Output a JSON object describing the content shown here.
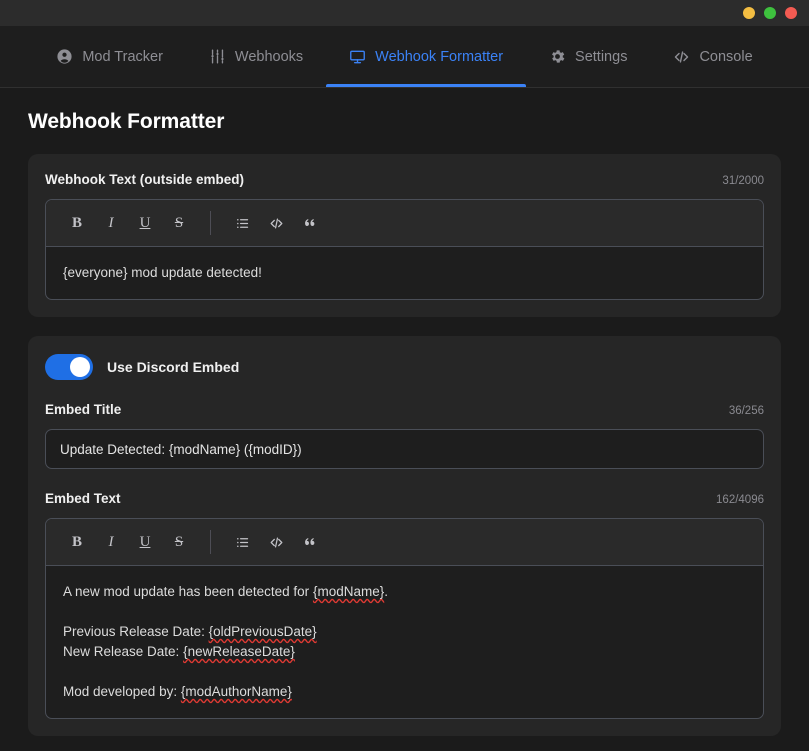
{
  "window": {
    "controls": [
      {
        "name": "minimize",
        "color": "#f3bd42"
      },
      {
        "name": "maximize",
        "color": "#3ec13e"
      },
      {
        "name": "close",
        "color": "#f35b52"
      }
    ]
  },
  "nav": {
    "tabs": [
      {
        "label": "Mod Tracker",
        "icon": "account-circle-icon",
        "active": false
      },
      {
        "label": "Webhooks",
        "icon": "tune-sliders-icon",
        "active": false
      },
      {
        "label": "Webhook Formatter",
        "icon": "monitor-icon",
        "active": true
      },
      {
        "label": "Settings",
        "icon": "gear-icon",
        "active": false
      },
      {
        "label": "Console",
        "icon": "code-icon",
        "active": false
      }
    ],
    "accent_color": "#3b82f6"
  },
  "page": {
    "title": "Webhook Formatter"
  },
  "toolbar": {
    "bold": "B",
    "italic": "I",
    "underline": "U",
    "strikethrough": "S",
    "list": "list-icon",
    "code": "code-icon",
    "quote": "quote-icon"
  },
  "webhook_text": {
    "label": "Webhook Text (outside embed)",
    "counter": "31/2000",
    "value": "{everyone} mod update detected!"
  },
  "embed": {
    "toggle_label": "Use Discord Embed",
    "toggle_on": true,
    "title": {
      "label": "Embed Title",
      "counter": "36/256",
      "value": "Update Detected: {modName} ({modID})"
    },
    "text": {
      "label": "Embed Text",
      "counter": "162/4096",
      "lines": [
        {
          "text": "A new mod update has been detected for ",
          "spell": "{modName}",
          "tail": "."
        },
        {
          "text": "",
          "spell": "",
          "tail": ""
        },
        {
          "text": "Previous Release Date: ",
          "spell": "{oldPreviousDate}",
          "tail": ""
        },
        {
          "text": "New Release Date: ",
          "spell": "{newReleaseDate}",
          "tail": ""
        },
        {
          "text": "",
          "spell": "",
          "tail": ""
        },
        {
          "text": "Mod developed by: ",
          "spell": "{modAuthorName}",
          "tail": ""
        }
      ]
    }
  }
}
